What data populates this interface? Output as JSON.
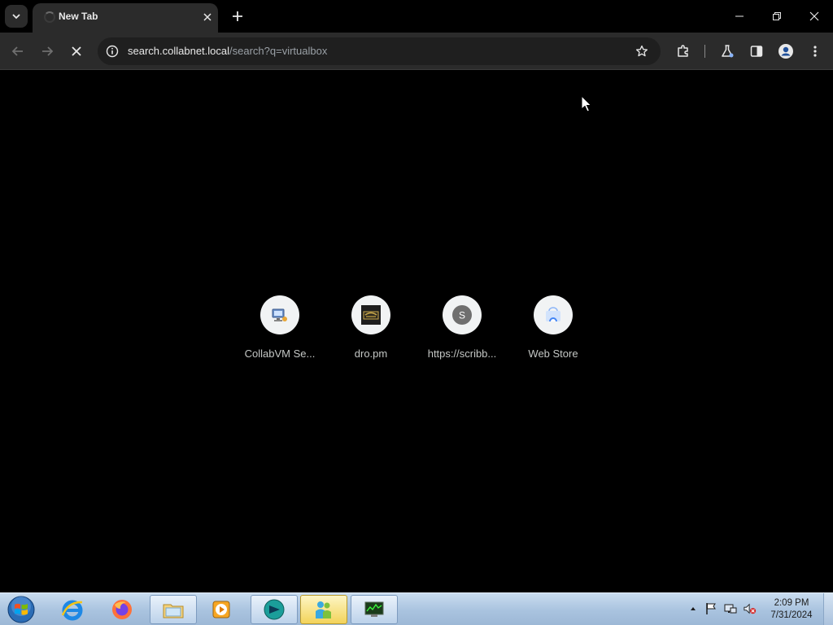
{
  "browser": {
    "tab": {
      "title": "New Tab"
    },
    "omnibox": {
      "host": "search.collabnet.local",
      "path": "/search?q=virtualbox"
    }
  },
  "shortcuts": [
    {
      "label": "CollabVM Se...",
      "icon": "collabvm-favicon"
    },
    {
      "label": "dro.pm",
      "icon": "dro-pm-favicon"
    },
    {
      "label": "https://scribb...",
      "icon": "letter-s-avatar",
      "letter": "S"
    },
    {
      "label": "Web Store",
      "icon": "web-store-favicon"
    }
  ],
  "taskbar": {
    "apps": [
      {
        "name": "internet-explorer",
        "state": "pinned"
      },
      {
        "name": "firefox",
        "state": "pinned"
      },
      {
        "name": "windows-explorer",
        "state": "open"
      },
      {
        "name": "media-player",
        "state": "pinned"
      },
      {
        "name": "chrome-like-browser",
        "state": "open"
      },
      {
        "name": "messenger",
        "state": "active"
      },
      {
        "name": "task-manager",
        "state": "open"
      }
    ],
    "clock": {
      "time": "2:09 PM",
      "date": "7/31/2024"
    }
  },
  "colors": {
    "page_bg": "#000000",
    "toolbar_bg": "#2b2b2b",
    "omnibox_bg": "#1f1f1f",
    "shortcut_circle": "#f1f3f4"
  }
}
